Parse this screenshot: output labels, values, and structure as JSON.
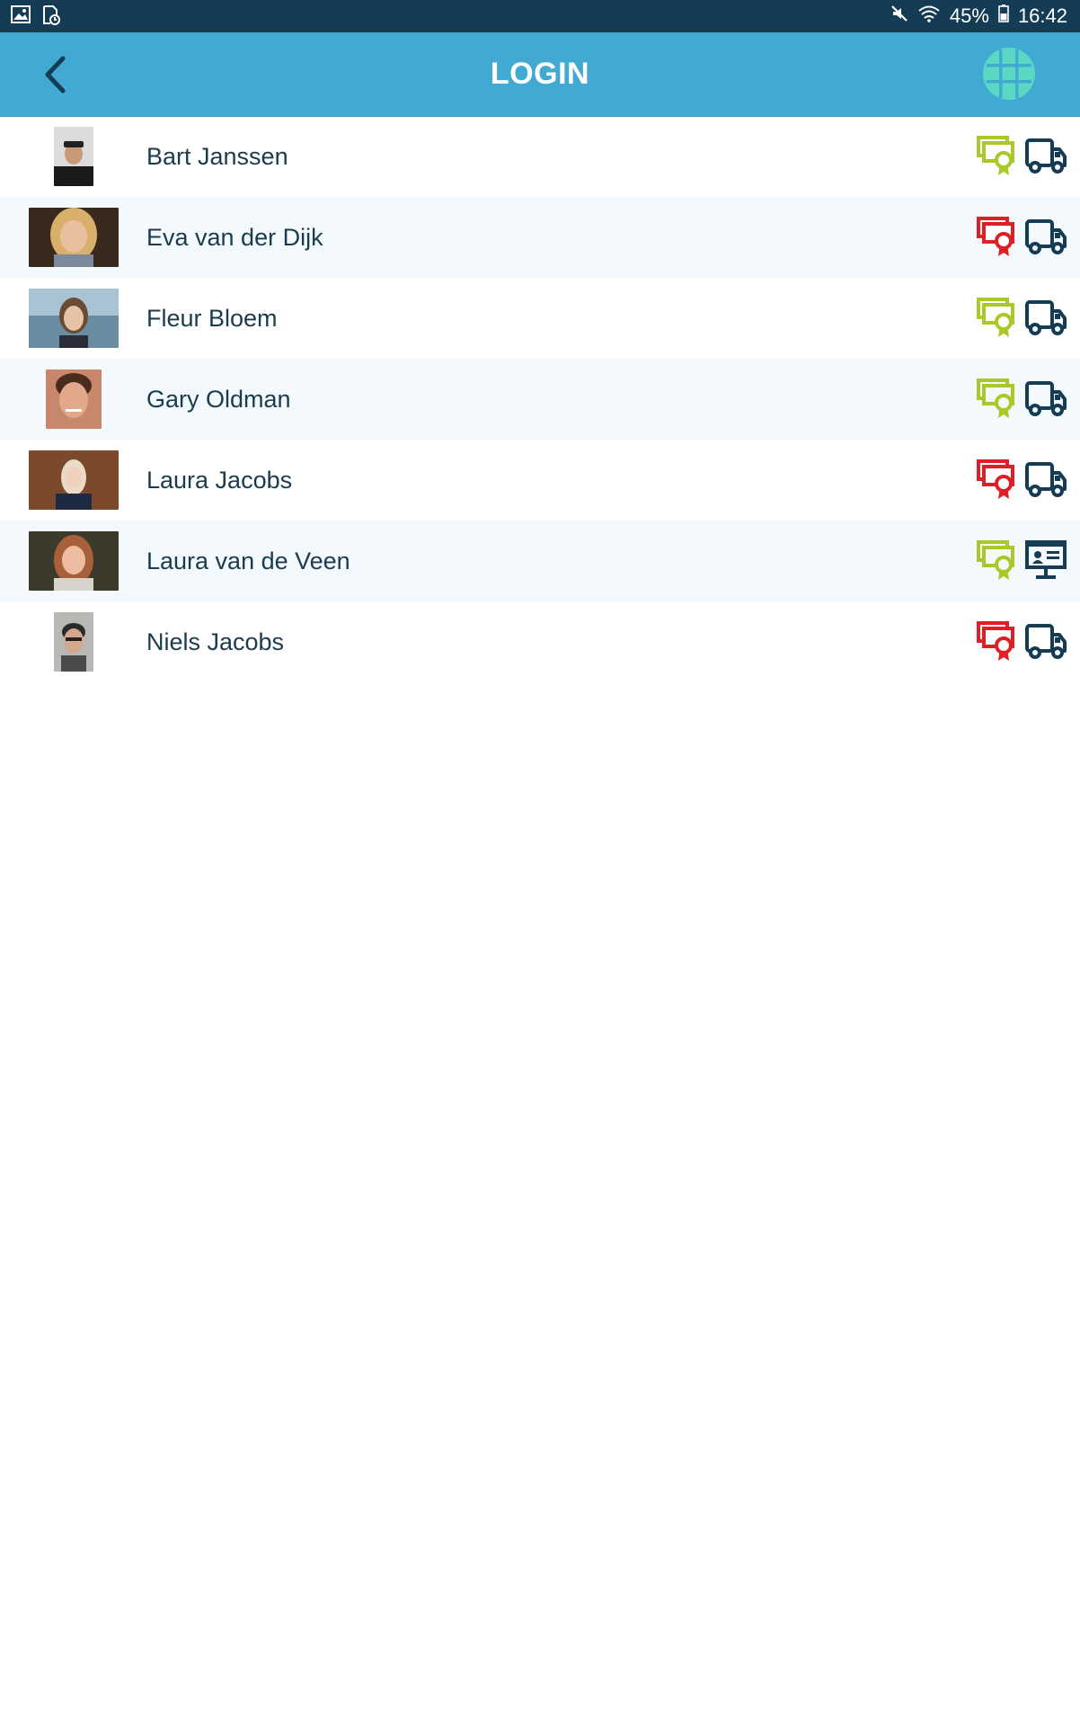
{
  "status": {
    "battery": "45%",
    "time": "16:42"
  },
  "header": {
    "title": "LOGIN"
  },
  "colors": {
    "status_bar": "#143c55",
    "app_bar": "#42a9d3",
    "cert_valid": "#a8c928",
    "cert_invalid": "#e01e26",
    "vehicle": "#143c55",
    "globe": "#5ad8c4"
  },
  "users": [
    {
      "name": "Bart Janssen",
      "certificate": "valid",
      "type": "truck-icon"
    },
    {
      "name": "Eva van der Dijk",
      "certificate": "invalid",
      "type": "truck-icon"
    },
    {
      "name": "Fleur Bloem",
      "certificate": "valid",
      "type": "truck-icon"
    },
    {
      "name": "Gary Oldman",
      "certificate": "valid",
      "type": "truck-icon"
    },
    {
      "name": "Laura Jacobs",
      "certificate": "invalid",
      "type": "truck-icon"
    },
    {
      "name": "Laura van de Veen",
      "certificate": "valid",
      "type": "presentation-icon"
    },
    {
      "name": "Niels Jacobs",
      "certificate": "invalid",
      "type": "truck-icon"
    }
  ]
}
